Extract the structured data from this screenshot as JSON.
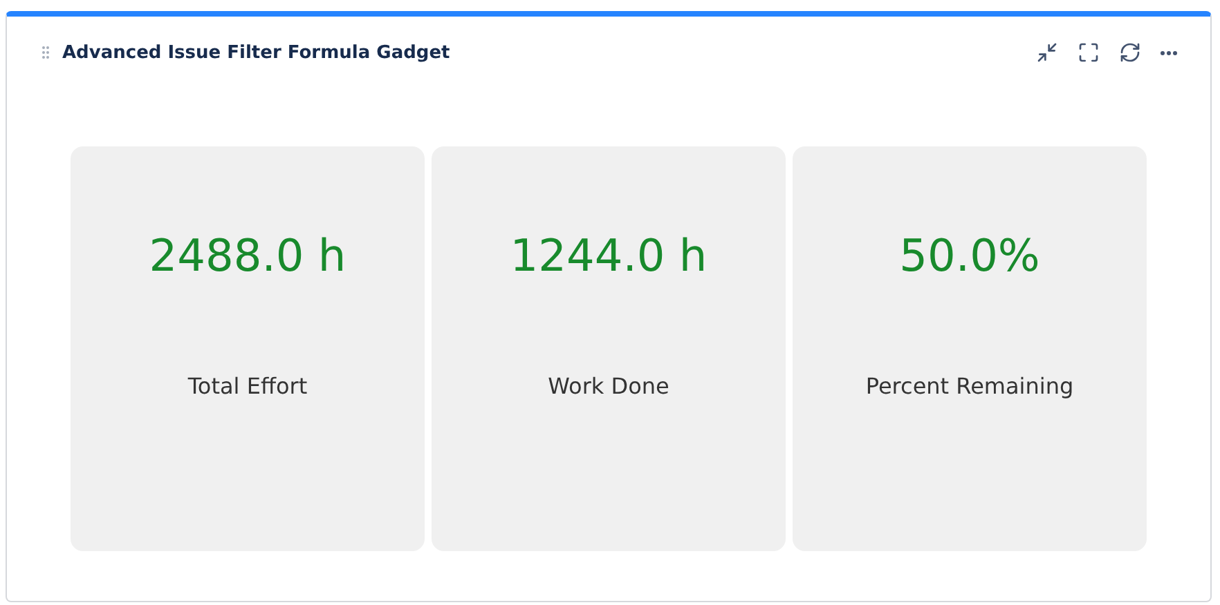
{
  "gadget": {
    "title": "Advanced Issue Filter Formula Gadget"
  },
  "metrics": [
    {
      "value": "2488.0 h",
      "label": "Total Effort"
    },
    {
      "value": "1244.0 h",
      "label": "Work Done"
    },
    {
      "value": "50.0%",
      "label": "Percent Remaining"
    }
  ]
}
